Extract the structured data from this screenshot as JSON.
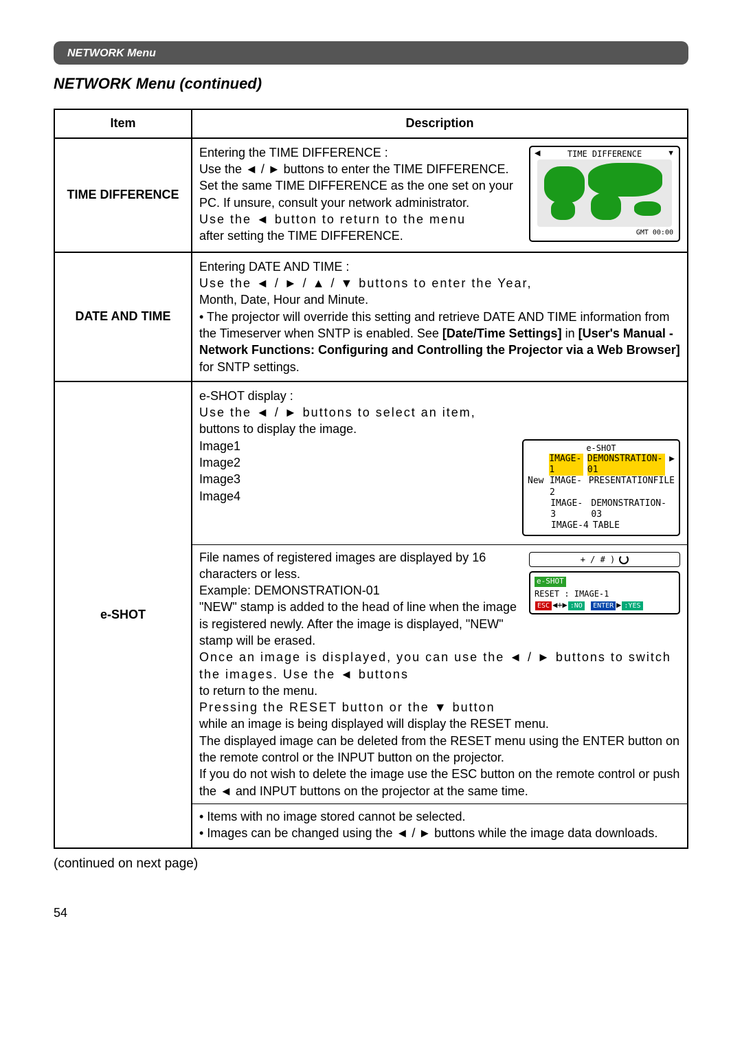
{
  "tab_label": "NETWORK Menu",
  "section_title": "NETWORK Menu (continued)",
  "headers": {
    "item": "Item",
    "desc": "Description"
  },
  "rows": {
    "time_diff": {
      "item": "TIME DIFFERENCE",
      "l1": "Entering the TIME DIFFERENCE :",
      "l2": "Use the  ◄ / ►  buttons to enter the TIME DIFFERENCE.",
      "l3": "Set the same TIME DIFFERENCE as the one set on your PC. If unsure, consult your network administrator.",
      "l4a": "Use the ◄ button to return to the menu",
      "l4b": "after setting the TIME DIFFERENCE.",
      "osd_title": "TIME DIFFERENCE",
      "osd_gmt": "GMT 00:00"
    },
    "date_time": {
      "item": "DATE AND TIME",
      "l1": "Entering DATE AND TIME :",
      "l2": "Use the ◄ / ► / ▲ / ▼ buttons to enter the Year,",
      "l3": "Month, Date, Hour and Minute.",
      "n1a": "• The projector will override this setting and retrieve  DATE AND TIME information from the Timeserver when SNTP is enabled. See ",
      "n1b": "[Date/Time Settings]",
      "n1c": " in ",
      "n1d": "[User's Manual - Network Functions: Configuring and Controlling the Projector via a Web Browser]",
      "n1e": " for SNTP settings."
    },
    "eshot": {
      "item": "e-SHOT",
      "l1": "e-SHOT display :",
      "l2": "Use the ◄ / ► buttons to select an item,",
      "l3": "buttons to display the image.",
      "img1": "Image1",
      "img2": "Image2",
      "img3": "Image3",
      "img4": "Image4",
      "p2": "File names of registered images are displayed by 16 characters or less.",
      "p3": "Example: DEMONSTRATION-01",
      "p4": "\"NEW\" stamp is added to the head of line when the image is registered newly. After the image is displayed, \"NEW\" stamp will be erased.",
      "p5a": "Once an image is displayed, you can use the ◄ / ► buttons to switch",
      "p5b": "the images. Use the ◄ buttons",
      "p5c": "to return to the menu.",
      "p6": "Pressing the RESET button or the ▼ button",
      "p7": "while an image is being displayed will display the RESET menu.",
      "p8": "The displayed image can be deleted from the RESET menu using the ENTER button on the remote control or the INPUT button on the projector.",
      "p9": "If you do not wish to delete the image use the ESC button on the remote control or push the  ◄  and INPUT buttons on the projector at the same time.",
      "b1": "• Items with no image stored cannot be selected.",
      "b2": "• Images can be changed using the  ◄ / ►  buttons while the image data downloads.",
      "osd1_title": "e-SHOT",
      "osd1_r1a": "IMAGE-1",
      "osd1_r1b": "DEMONSTRATION-01",
      "osd1_r2n": "New",
      "osd1_r2a": "IMAGE-2",
      "osd1_r2b": "PRESENTATIONFILE",
      "osd1_r3a": "IMAGE-3",
      "osd1_r3b": "DEMONSTRATION-03",
      "osd1_r4a": "IMAGE-4",
      "osd1_r4b": "TABLE",
      "osd_ind": "+ / # )",
      "osd2_hdr": "e-SHOT",
      "osd2_l1": "RESET : IMAGE-1",
      "osd2_esc": "ESC",
      "osd2_no": ":NO",
      "osd2_ent": "ENTER",
      "osd2_yes": ":YES"
    }
  },
  "cont": "(continued on next page)",
  "page_num": "54"
}
